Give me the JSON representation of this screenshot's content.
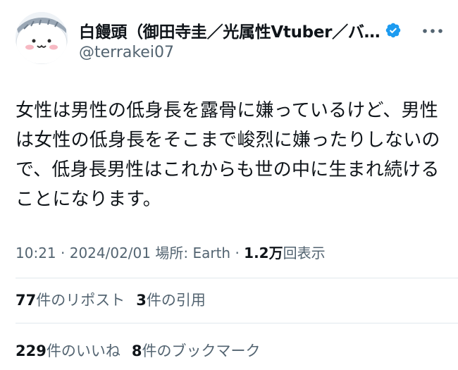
{
  "author": {
    "display_name": "白饅頭（御田寺圭／光属性Vtuber／バ…",
    "handle": "@terrakei07",
    "verified": true,
    "avatar": "shiromanjuu-avatar-icon"
  },
  "icons": {
    "verified": "verified-badge-icon",
    "more": "more-options-icon"
  },
  "colors": {
    "verified": "#1d9bf0",
    "secondary_text": "#536471",
    "primary_text": "#0f1419",
    "divider": "#e1e8ed"
  },
  "tweet": {
    "lines": [
      "女性は男性の低身長を露骨に嫌っているけど、男性",
      "は女性の低身長をそこまで峻烈に嫌ったりしないの",
      "で、低身長男性はこれからも世の中に生まれ続ける",
      "ことになります。"
    ]
  },
  "meta": {
    "time": "10:21",
    "sep1": " · ",
    "date": "2024/02/01",
    "location_label": " 場所: Earth",
    "sep2": " · ",
    "views_count": "1.2万",
    "views_label": "回表示"
  },
  "stats": {
    "reposts_count": "77",
    "reposts_label": "件のリポスト",
    "quotes_count": "3",
    "quotes_label": "件の引用",
    "likes_count": "229",
    "likes_label": "件のいいね",
    "bookmarks_count": "8",
    "bookmarks_label": "件のブックマーク"
  }
}
